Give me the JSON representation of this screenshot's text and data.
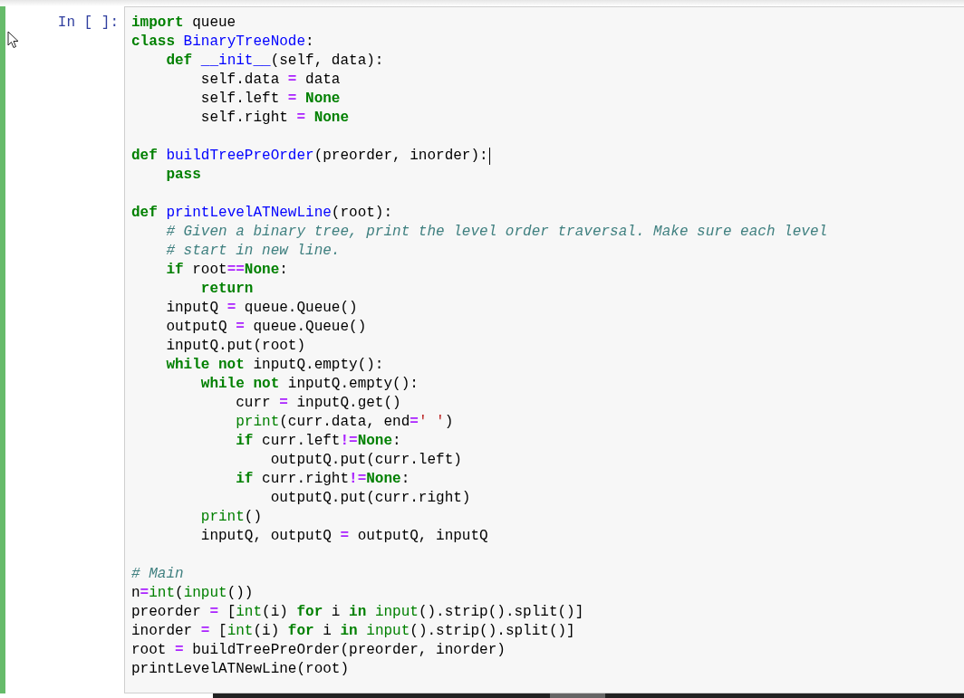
{
  "cell": {
    "selected": true,
    "edit_mode": true,
    "prompt": "In [ ]:",
    "lines": [
      {
        "kind": "code",
        "tokens": [
          {
            "kind": "kw",
            "text": "import"
          },
          {
            "kind": "tx",
            "text": " queue"
          }
        ]
      },
      {
        "kind": "code",
        "tokens": [
          {
            "kind": "kw",
            "text": "class"
          },
          {
            "kind": "nm",
            "text": " BinaryTreeNode"
          },
          {
            "kind": "tx",
            "text": ":"
          }
        ]
      },
      {
        "kind": "code",
        "tokens": [
          {
            "kind": "kw",
            "text": "    def"
          },
          {
            "kind": "nm",
            "text": " __init__"
          },
          {
            "kind": "tx",
            "text": "(self, data):"
          }
        ]
      },
      {
        "kind": "code",
        "tokens": [
          {
            "kind": "tx",
            "text": "        self.data "
          },
          {
            "kind": "op",
            "text": "="
          },
          {
            "kind": "tx",
            "text": " data"
          }
        ]
      },
      {
        "kind": "code",
        "tokens": [
          {
            "kind": "tx",
            "text": "        self.left "
          },
          {
            "kind": "op",
            "text": "="
          },
          {
            "kind": "kw",
            "text": " None"
          }
        ]
      },
      {
        "kind": "code",
        "tokens": [
          {
            "kind": "tx",
            "text": "        self.right "
          },
          {
            "kind": "op",
            "text": "="
          },
          {
            "kind": "kw",
            "text": " None"
          }
        ]
      },
      {
        "kind": "blank"
      },
      {
        "kind": "code",
        "tokens": [
          {
            "kind": "kw",
            "text": "def"
          },
          {
            "kind": "nm",
            "text": " buildTreePreOrder"
          },
          {
            "kind": "tx",
            "text": "(preorder, inorder):"
          },
          {
            "kind": "caret"
          }
        ]
      },
      {
        "kind": "code",
        "tokens": [
          {
            "kind": "kw",
            "text": "    pass"
          }
        ]
      },
      {
        "kind": "blank"
      },
      {
        "kind": "code",
        "tokens": [
          {
            "kind": "kw",
            "text": "def"
          },
          {
            "kind": "nm",
            "text": " printLevelATNewLine"
          },
          {
            "kind": "tx",
            "text": "(root):"
          }
        ]
      },
      {
        "kind": "code",
        "tokens": [
          {
            "kind": "cm",
            "text": "    # Given a binary tree, print the level order traversal. Make sure each level"
          }
        ]
      },
      {
        "kind": "code",
        "tokens": [
          {
            "kind": "cm",
            "text": "    # start in new line."
          }
        ]
      },
      {
        "kind": "code",
        "tokens": [
          {
            "kind": "kw",
            "text": "    if"
          },
          {
            "kind": "tx",
            "text": " root"
          },
          {
            "kind": "op",
            "text": "=="
          },
          {
            "kind": "kw",
            "text": "None"
          },
          {
            "kind": "tx",
            "text": ":"
          }
        ]
      },
      {
        "kind": "code",
        "tokens": [
          {
            "kind": "kw",
            "text": "        return"
          }
        ]
      },
      {
        "kind": "code",
        "tokens": [
          {
            "kind": "tx",
            "text": "    inputQ "
          },
          {
            "kind": "op",
            "text": "="
          },
          {
            "kind": "tx",
            "text": " queue.Queue()"
          }
        ]
      },
      {
        "kind": "code",
        "tokens": [
          {
            "kind": "tx",
            "text": "    outputQ "
          },
          {
            "kind": "op",
            "text": "="
          },
          {
            "kind": "tx",
            "text": " queue.Queue()"
          }
        ]
      },
      {
        "kind": "code",
        "tokens": [
          {
            "kind": "tx",
            "text": "    inputQ.put(root)"
          }
        ]
      },
      {
        "kind": "code",
        "tokens": [
          {
            "kind": "kw",
            "text": "    while not"
          },
          {
            "kind": "tx",
            "text": " inputQ.empty():"
          }
        ]
      },
      {
        "kind": "code",
        "tokens": [
          {
            "kind": "kw",
            "text": "        while not"
          },
          {
            "kind": "tx",
            "text": " inputQ.empty():"
          }
        ]
      },
      {
        "kind": "code",
        "tokens": [
          {
            "kind": "tx",
            "text": "            curr "
          },
          {
            "kind": "op",
            "text": "="
          },
          {
            "kind": "tx",
            "text": " inputQ.get()"
          }
        ]
      },
      {
        "kind": "code",
        "tokens": [
          {
            "kind": "bi",
            "text": "            print"
          },
          {
            "kind": "tx",
            "text": "(curr.data, end"
          },
          {
            "kind": "op",
            "text": "="
          },
          {
            "kind": "st",
            "text": "' '"
          },
          {
            "kind": "tx",
            "text": ")"
          }
        ]
      },
      {
        "kind": "code",
        "tokens": [
          {
            "kind": "kw",
            "text": "            if"
          },
          {
            "kind": "tx",
            "text": " curr.left"
          },
          {
            "kind": "op",
            "text": "!="
          },
          {
            "kind": "kw",
            "text": "None"
          },
          {
            "kind": "tx",
            "text": ":"
          }
        ]
      },
      {
        "kind": "code",
        "tokens": [
          {
            "kind": "tx",
            "text": "                outputQ.put(curr.left)"
          }
        ]
      },
      {
        "kind": "code",
        "tokens": [
          {
            "kind": "kw",
            "text": "            if"
          },
          {
            "kind": "tx",
            "text": " curr.right"
          },
          {
            "kind": "op",
            "text": "!="
          },
          {
            "kind": "kw",
            "text": "None"
          },
          {
            "kind": "tx",
            "text": ":"
          }
        ]
      },
      {
        "kind": "code",
        "tokens": [
          {
            "kind": "tx",
            "text": "                outputQ.put(curr.right)"
          }
        ]
      },
      {
        "kind": "code",
        "tokens": [
          {
            "kind": "bi",
            "text": "        print"
          },
          {
            "kind": "tx",
            "text": "()"
          }
        ]
      },
      {
        "kind": "code",
        "tokens": [
          {
            "kind": "tx",
            "text": "        inputQ, outputQ "
          },
          {
            "kind": "op",
            "text": "="
          },
          {
            "kind": "tx",
            "text": " outputQ, inputQ"
          }
        ]
      },
      {
        "kind": "blank"
      },
      {
        "kind": "code",
        "tokens": [
          {
            "kind": "cm",
            "text": "# Main"
          }
        ]
      },
      {
        "kind": "code",
        "tokens": [
          {
            "kind": "tx",
            "text": "n"
          },
          {
            "kind": "op",
            "text": "="
          },
          {
            "kind": "bi",
            "text": "int"
          },
          {
            "kind": "tx",
            "text": "("
          },
          {
            "kind": "bi",
            "text": "input"
          },
          {
            "kind": "tx",
            "text": "())"
          }
        ]
      },
      {
        "kind": "code",
        "tokens": [
          {
            "kind": "tx",
            "text": "preorder "
          },
          {
            "kind": "op",
            "text": "="
          },
          {
            "kind": "tx",
            "text": " ["
          },
          {
            "kind": "bi",
            "text": "int"
          },
          {
            "kind": "tx",
            "text": "(i) "
          },
          {
            "kind": "kw",
            "text": "for"
          },
          {
            "kind": "tx",
            "text": " i "
          },
          {
            "kind": "kw",
            "text": "in"
          },
          {
            "kind": "bi",
            "text": " input"
          },
          {
            "kind": "tx",
            "text": "().strip().split()]"
          }
        ]
      },
      {
        "kind": "code",
        "tokens": [
          {
            "kind": "tx",
            "text": "inorder "
          },
          {
            "kind": "op",
            "text": "="
          },
          {
            "kind": "tx",
            "text": " ["
          },
          {
            "kind": "bi",
            "text": "int"
          },
          {
            "kind": "tx",
            "text": "(i) "
          },
          {
            "kind": "kw",
            "text": "for"
          },
          {
            "kind": "tx",
            "text": " i "
          },
          {
            "kind": "kw",
            "text": "in"
          },
          {
            "kind": "bi",
            "text": " input"
          },
          {
            "kind": "tx",
            "text": "().strip().split()]"
          }
        ]
      },
      {
        "kind": "code",
        "tokens": [
          {
            "kind": "tx",
            "text": "root "
          },
          {
            "kind": "op",
            "text": "="
          },
          {
            "kind": "tx",
            "text": " buildTreePreOrder(preorder, inorder)"
          }
        ]
      },
      {
        "kind": "code",
        "tokens": [
          {
            "kind": "tx",
            "text": "printLevelATNewLine(root)"
          }
        ]
      }
    ]
  }
}
